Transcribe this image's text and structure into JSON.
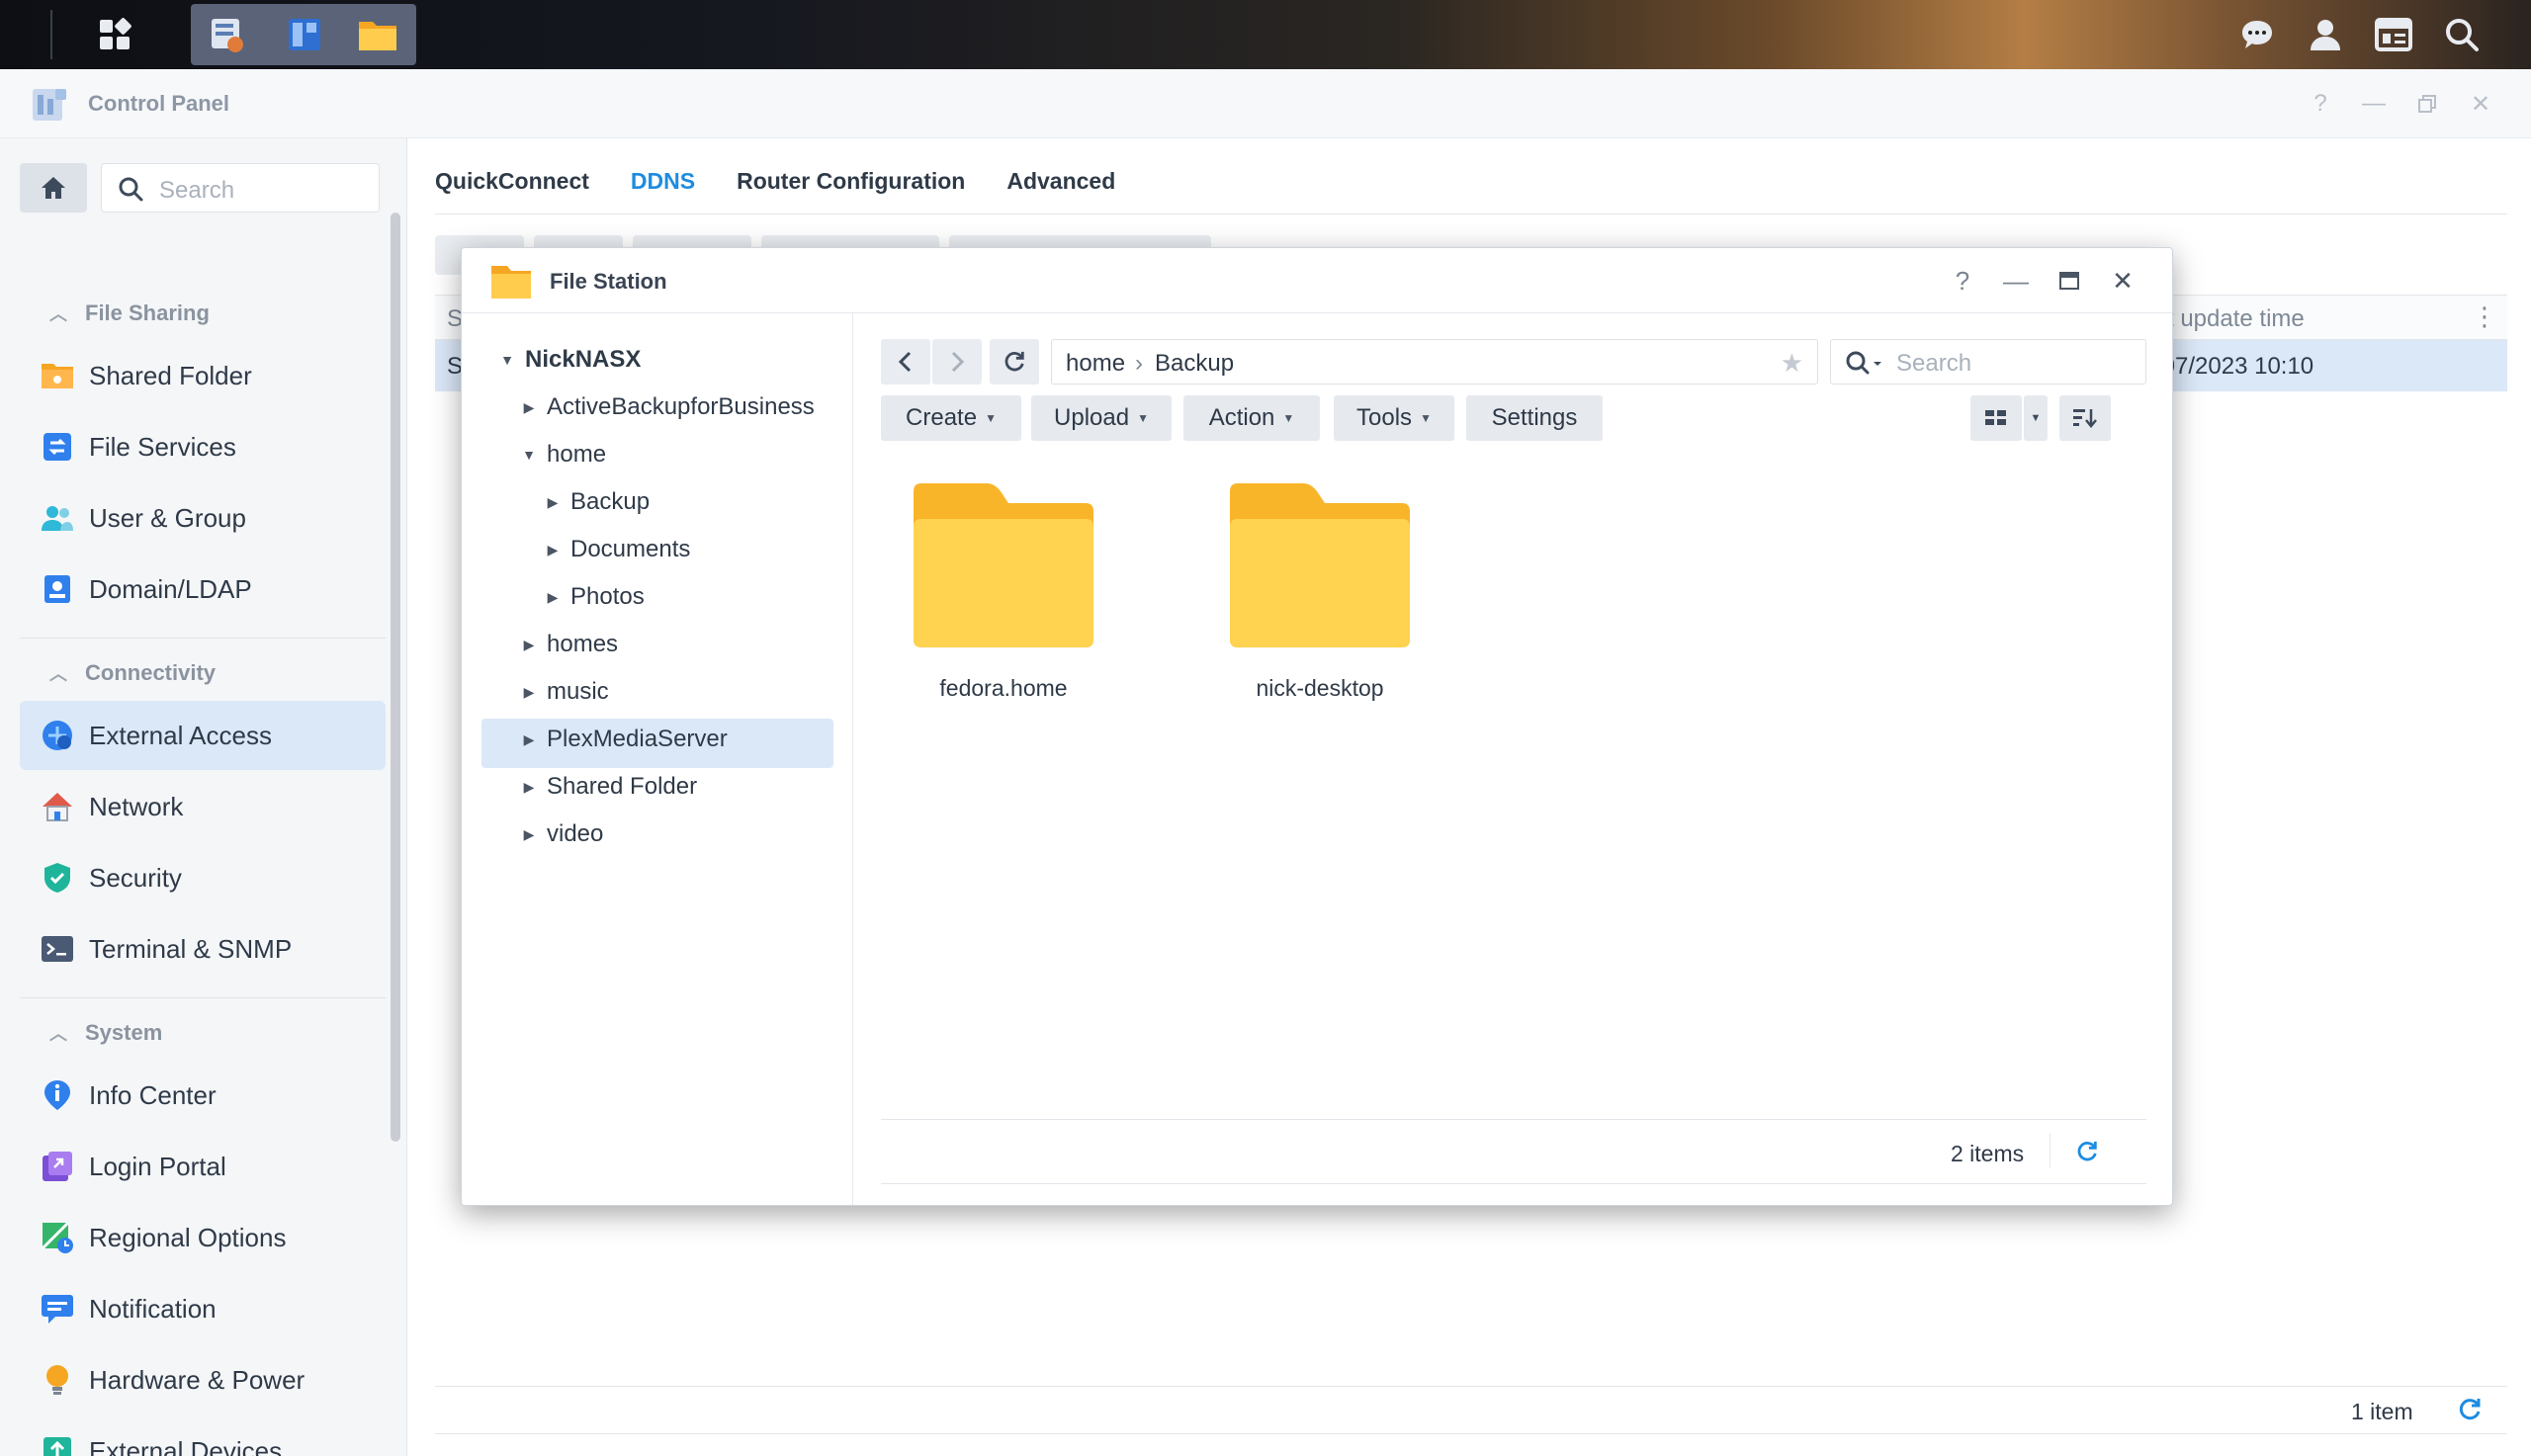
{
  "control_panel": {
    "title": "Control Panel",
    "search_placeholder": "Search",
    "sidebar": {
      "sections": [
        {
          "label": "File Sharing"
        },
        {
          "label": "Connectivity"
        },
        {
          "label": "System"
        }
      ],
      "items": [
        {
          "label": "Shared Folder",
          "icon": "shared-folder-icon"
        },
        {
          "label": "File Services",
          "icon": "file-services-icon"
        },
        {
          "label": "User & Group",
          "icon": "user-group-icon"
        },
        {
          "label": "Domain/LDAP",
          "icon": "domain-ldap-icon"
        },
        {
          "label": "External Access",
          "icon": "external-access-icon",
          "active": true
        },
        {
          "label": "Network",
          "icon": "network-icon"
        },
        {
          "label": "Security",
          "icon": "security-icon"
        },
        {
          "label": "Terminal & SNMP",
          "icon": "terminal-icon"
        },
        {
          "label": "Info Center",
          "icon": "info-icon"
        },
        {
          "label": "Login Portal",
          "icon": "login-portal-icon"
        },
        {
          "label": "Regional Options",
          "icon": "regional-options-icon"
        },
        {
          "label": "Notification",
          "icon": "notification-icon"
        },
        {
          "label": "Hardware & Power",
          "icon": "hardware-power-icon"
        },
        {
          "label": "External Devices",
          "icon": "external-devices-icon"
        }
      ]
    },
    "tabs": [
      {
        "label": "QuickConnect"
      },
      {
        "label": "DDNS",
        "active": true
      },
      {
        "label": "Router Configuration"
      },
      {
        "label": "Advanced"
      }
    ],
    "grid": {
      "header_first": "S",
      "header_last_col": "st update time",
      "row_first": "S",
      "row_last_col": "/07/2023 10:10"
    },
    "footer_count": "1 item"
  },
  "file_station": {
    "title": "File Station",
    "tree": {
      "root": "NickNASX",
      "nodes": [
        {
          "label": "ActiveBackupforBusiness"
        },
        {
          "label": "home"
        },
        {
          "label": "Backup",
          "selected": true
        },
        {
          "label": "Documents"
        },
        {
          "label": "Photos"
        },
        {
          "label": "homes"
        },
        {
          "label": "music"
        },
        {
          "label": "PlexMediaServer"
        },
        {
          "label": "Shared Folder"
        },
        {
          "label": "video"
        }
      ]
    },
    "path": [
      "home",
      "Backup"
    ],
    "search_placeholder": "Search",
    "toolbar": {
      "create": "Create",
      "upload": "Upload",
      "action": "Action",
      "tools": "Tools",
      "settings": "Settings"
    },
    "files": [
      {
        "name": "fedora.home",
        "type": "folder"
      },
      {
        "name": "nick-desktop",
        "type": "folder"
      }
    ],
    "status_count": "2 items"
  },
  "colors": {
    "accent": "#1d8ce0",
    "folder": "#fbc02d",
    "selection": "#dbe8f8"
  }
}
